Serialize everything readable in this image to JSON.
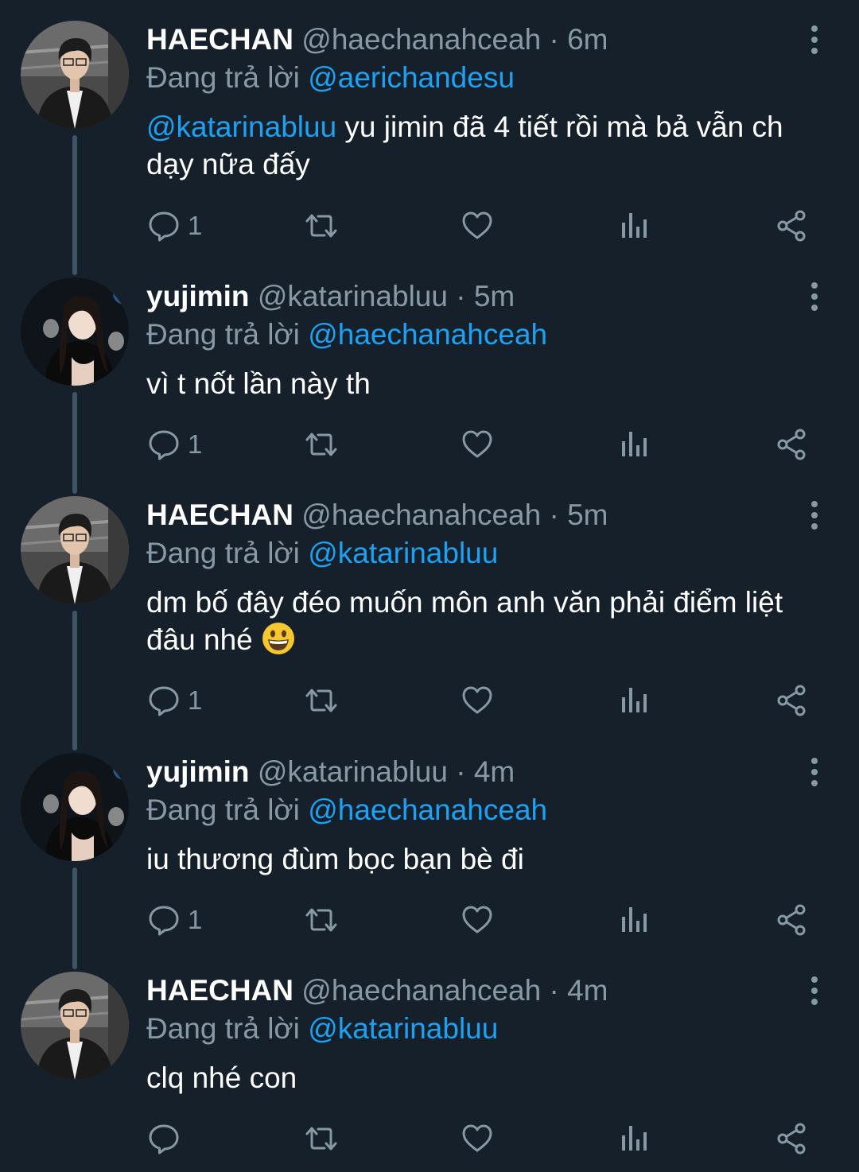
{
  "tweets": [
    {
      "name": "HAECHAN",
      "handle": "@haechanahceah",
      "separator": "·",
      "time": "6m",
      "reply_prefix": "Đang trả lời",
      "reply_to": "@aerichandesu",
      "mention": "@katarinabluu",
      "text": " yu jimin đã 4 tiết rồi mà bả vẫn ch dạy nữa đấy",
      "reply_count": "1",
      "avatar": "haechan"
    },
    {
      "name": "yujimin",
      "handle": "@katarinabluu",
      "separator": "·",
      "time": "5m",
      "reply_prefix": "Đang trả lời",
      "reply_to": "@haechanahceah",
      "mention": "",
      "text": "vì t nốt lần này th",
      "reply_count": "1",
      "avatar": "yujimin"
    },
    {
      "name": "HAECHAN",
      "handle": "@haechanahceah",
      "separator": "·",
      "time": "5m",
      "reply_prefix": "Đang trả lời",
      "reply_to": "@katarinabluu",
      "mention": "",
      "text": "dm bố đây đéo muốn môn anh văn phải điểm liệt đâu nhé",
      "reply_count": "1",
      "avatar": "haechan",
      "emoji": "grinning-face-emoji"
    },
    {
      "name": "yujimin",
      "handle": "@katarinabluu",
      "separator": "·",
      "time": "4m",
      "reply_prefix": "Đang trả lời",
      "reply_to": "@haechanahceah",
      "mention": "",
      "text": "iu thương đùm bọc bạn bè đi",
      "reply_count": "1",
      "avatar": "yujimin"
    },
    {
      "name": "HAECHAN",
      "handle": "@haechanahceah",
      "separator": "·",
      "time": "4m",
      "reply_prefix": "Đang trả lời",
      "reply_to": "@katarinabluu",
      "mention": "",
      "text": "clq nhé con",
      "reply_count": "",
      "avatar": "haechan"
    }
  ],
  "icons": {
    "reply": "reply-icon",
    "retweet": "retweet-icon",
    "like": "like-icon",
    "analytics": "analytics-icon",
    "share": "share-icon",
    "more": "more-options-icon"
  },
  "colors": {
    "background": "#15202b",
    "secondary_text": "#8899a6",
    "accent": "#1da1f2",
    "thread_line": "#3d5466"
  }
}
